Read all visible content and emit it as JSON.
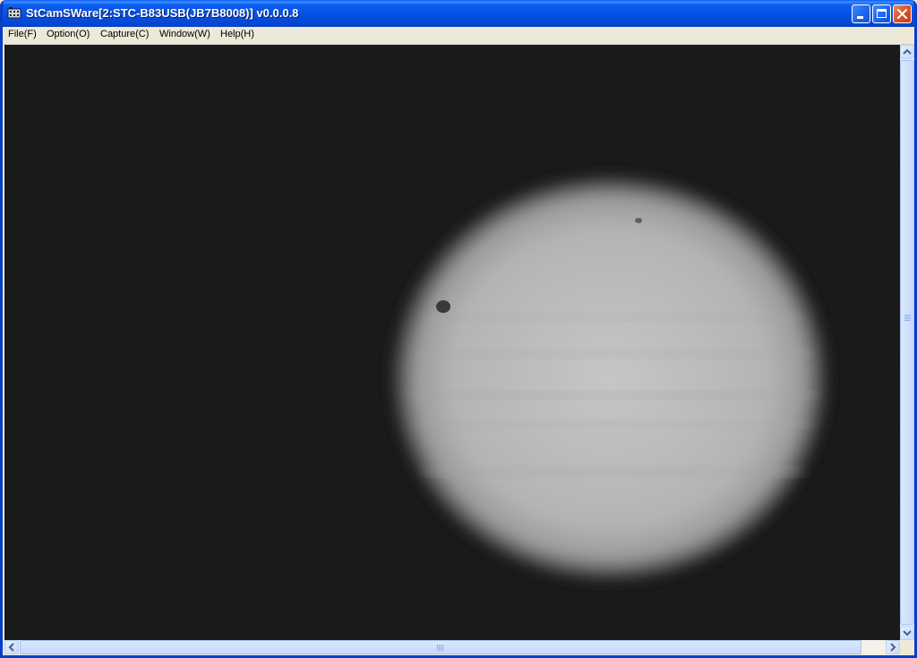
{
  "window": {
    "title": "StCamSWare[2:STC-B83USB(JB7B8008)] v0.0.0.8",
    "icons": {
      "app": "camera-app-icon",
      "minimize": "minimize-icon",
      "maximize": "maximize-icon",
      "close": "close-icon"
    }
  },
  "menu": {
    "items": [
      {
        "label": "File(F)"
      },
      {
        "label": "Option(O)"
      },
      {
        "label": "Capture(C)"
      },
      {
        "label": "Window(W)"
      },
      {
        "label": "Help(H)"
      }
    ]
  },
  "viewport": {
    "content": "planet-image"
  },
  "colors": {
    "title_bar": "#0650e4",
    "menu_bg": "#ece9d8",
    "viewport_bg": "#141414",
    "planet": "#b9b9b9"
  }
}
